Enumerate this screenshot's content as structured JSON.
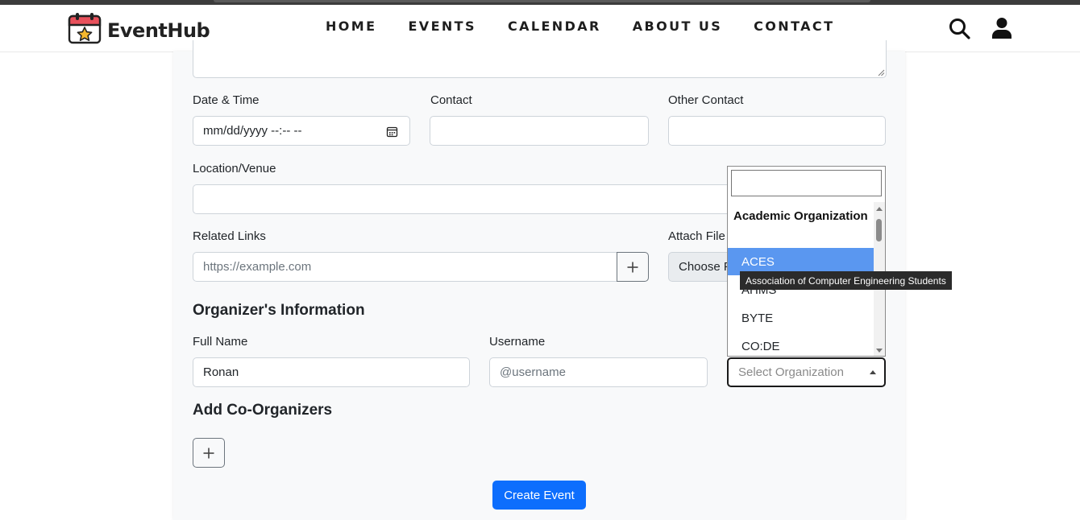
{
  "brand": {
    "name": "EventHub"
  },
  "nav": {
    "links": [
      "HOME",
      "EVENTS",
      "CALENDAR",
      "ABOUT US",
      "CONTACT"
    ],
    "icons": [
      "search-icon",
      "user-icon"
    ]
  },
  "form": {
    "datetime": {
      "label": "Date & Time",
      "placeholder": "mm/dd/yyyy --:-- --"
    },
    "contact": {
      "label": "Contact",
      "value": ""
    },
    "other_contact": {
      "label": "Other Contact",
      "value": ""
    },
    "location": {
      "label": "Location/Venue",
      "value": ""
    },
    "related_links": {
      "label": "Related Links",
      "placeholder": "https://example.com"
    },
    "attach_file": {
      "label": "Attach File",
      "button": "Choose F"
    },
    "organizer": {
      "title": "Organizer's Information",
      "full_name": {
        "label": "Full Name",
        "value": "Ronan"
      },
      "username": {
        "label": "Username",
        "placeholder": "@username"
      },
      "organization": {
        "placeholder": "Select Organization"
      }
    },
    "co_organizers": {
      "title": "Add Co-Organizers"
    },
    "submit": "Create Event"
  },
  "org_dropdown": {
    "search_value": "",
    "group": "Academic Organization",
    "options": [
      "ACES",
      "AHMS",
      "BYTE",
      "CO:DE"
    ],
    "highlighted": "ACES",
    "tooltip": "Association of Computer Engineering Students"
  },
  "colors": {
    "primary": "#0d6efd",
    "highlight": "#5a97f0",
    "calendar_red": "#e8505b",
    "star_yellow": "#f5b82e"
  }
}
